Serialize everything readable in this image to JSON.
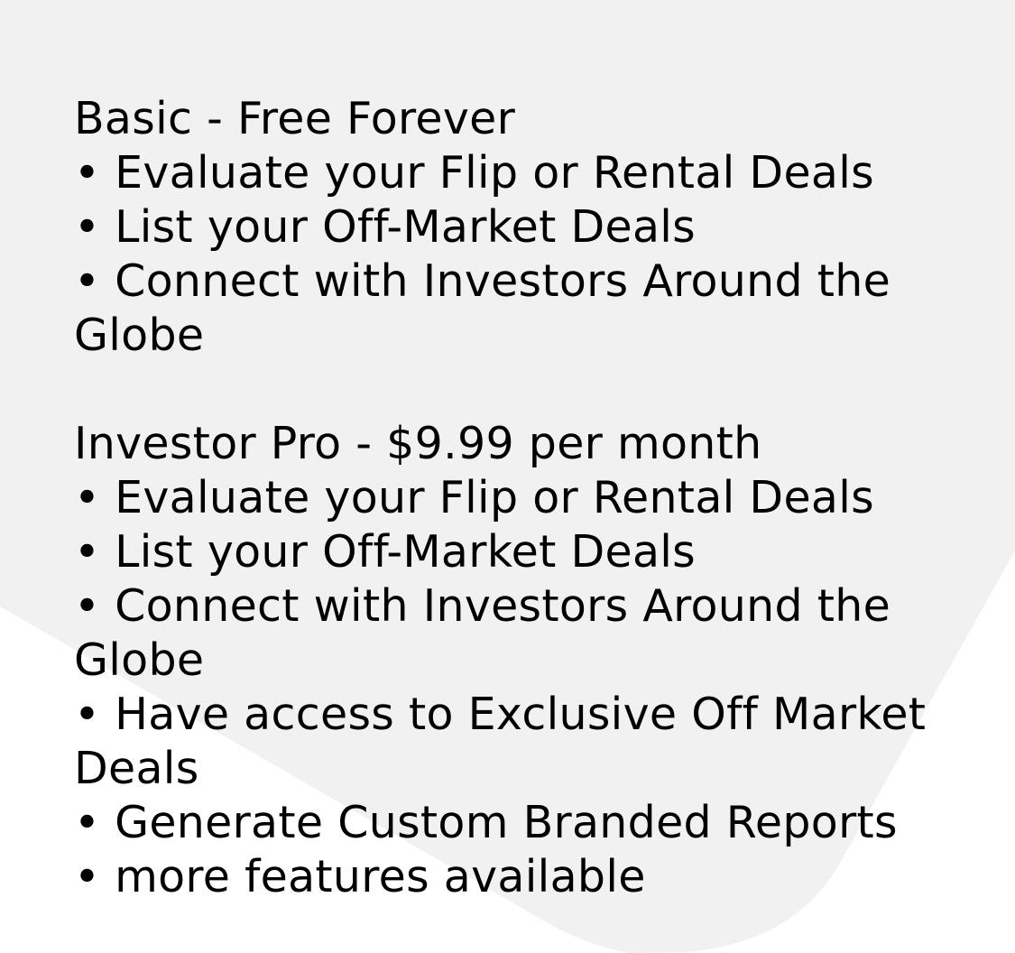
{
  "colors": {
    "background_shape": "#f1f1f1",
    "page_background": "#ffffff",
    "text": "#000000"
  },
  "bullet_char": "•",
  "plans": [
    {
      "title": "Basic - Free Forever",
      "features": [
        "Evaluate your Flip or Rental Deals",
        "List your Off-Market Deals",
        "Connect with Investors Around the Globe"
      ]
    },
    {
      "title": "Investor Pro - $9.99 per month",
      "features": [
        "Evaluate your Flip or Rental Deals",
        "List your Off-Market Deals",
        "Connect with Investors Around the Globe",
        "Have access to Exclusive Off Market Deals",
        "Generate Custom Branded Reports",
        "more features available"
      ]
    }
  ]
}
